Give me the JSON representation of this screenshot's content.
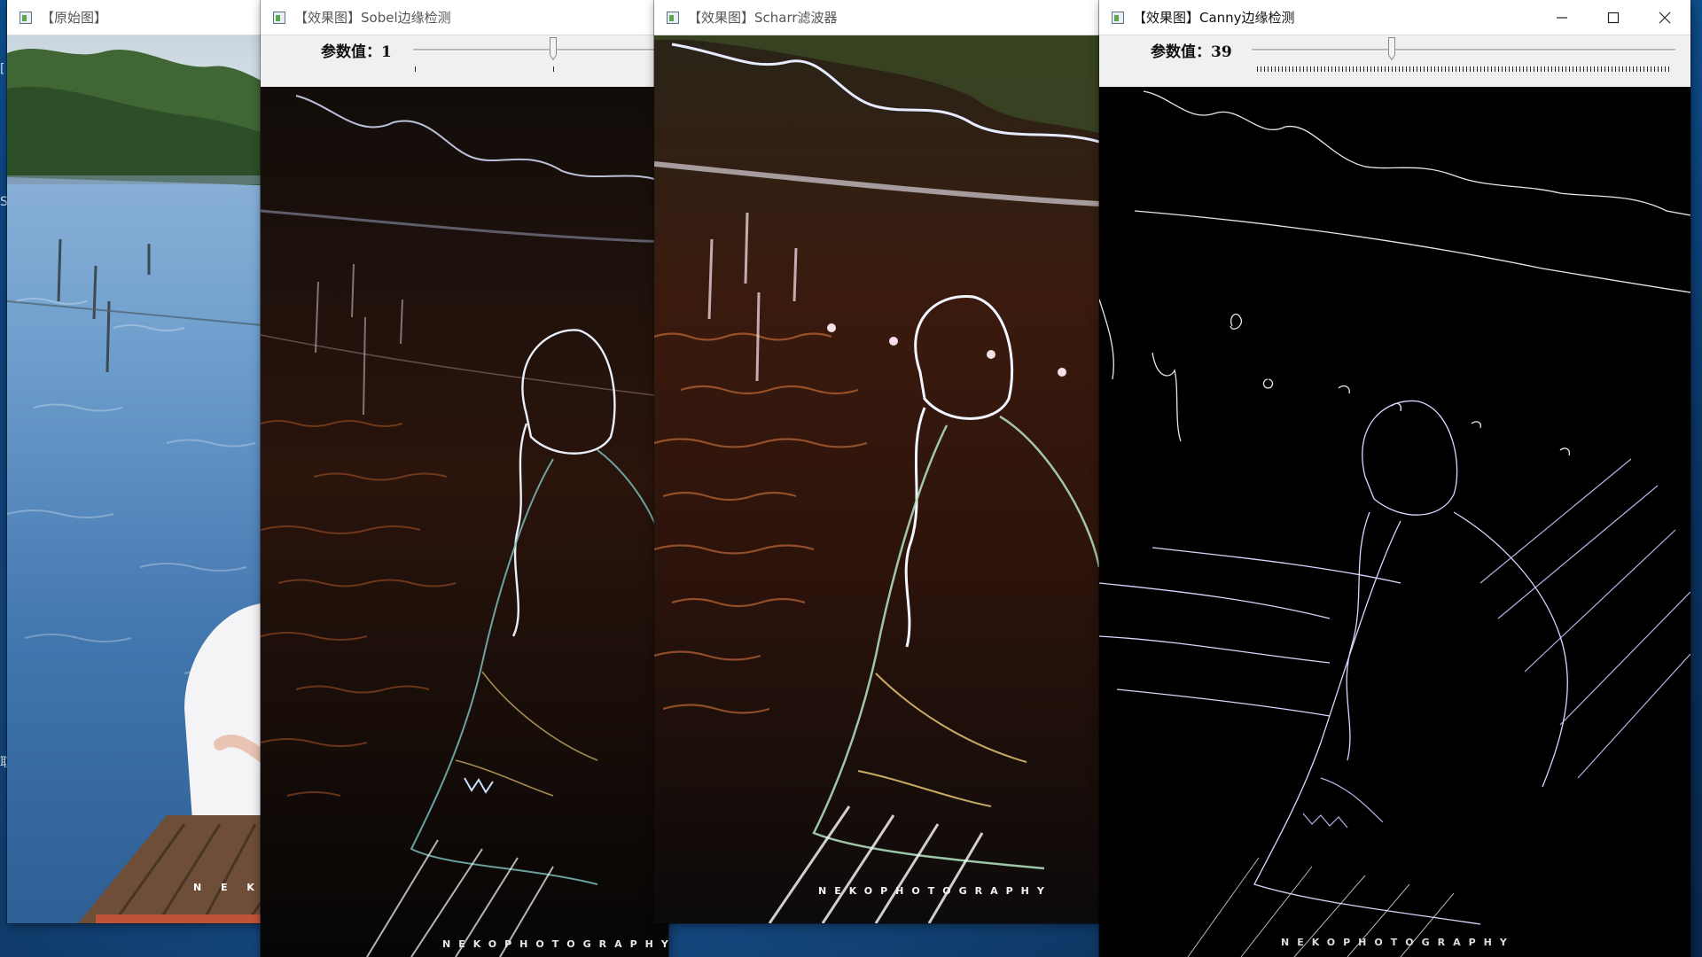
{
  "desktop": {
    "edge_glyphs": [
      "[",
      "S",
      "取"
    ]
  },
  "windows": [
    {
      "id": "original",
      "title": "【原始图】",
      "watermark": "N E K O",
      "active": false
    },
    {
      "id": "sobel",
      "title": "【效果图】Sobel边缘检测",
      "trackbar_label": "参数值：",
      "trackbar_value": "1",
      "trackbar_position": 0.35,
      "watermark": "NEKOPHOTOGRAPHY",
      "active": false
    },
    {
      "id": "scharr",
      "title": "【效果图】Scharr滤波器",
      "watermark": "NEKOPHOTOGRAPHY",
      "active": false
    },
    {
      "id": "canny",
      "title": "【效果图】Canny边缘检测",
      "trackbar_label": "参数值：",
      "trackbar_value": "39",
      "trackbar_position": 0.33,
      "watermark": "NEKOPHOTOGRAPHY",
      "active": true,
      "controls": {
        "minimize_icon": "minimize-icon",
        "maximize_icon": "maximize-icon",
        "close_icon": "close-icon"
      }
    }
  ]
}
